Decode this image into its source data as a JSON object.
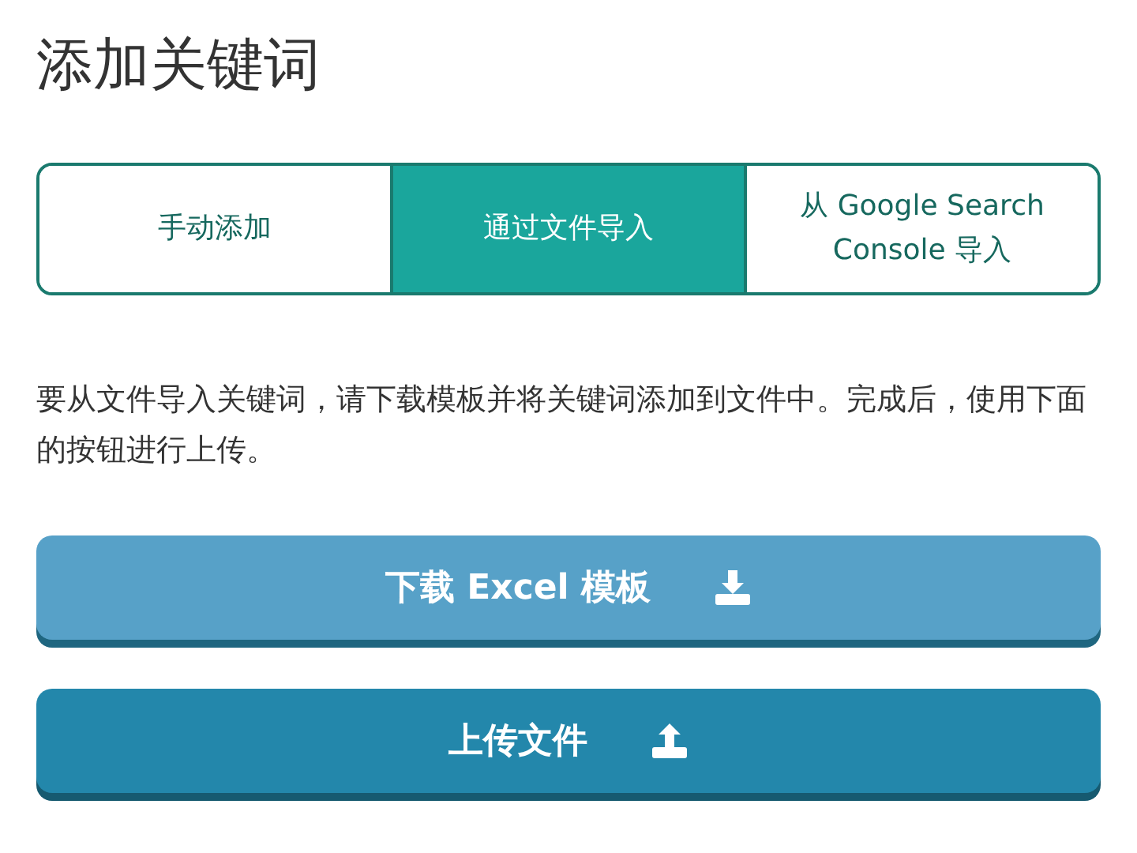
{
  "title": "添加关键词",
  "tabs": [
    {
      "label": "手动添加",
      "selected": false
    },
    {
      "label": "通过文件导入",
      "selected": true
    },
    {
      "label": "从 Google Search Console 导入",
      "selected": false
    }
  ],
  "instructions": "要从文件导入关键词，请下载模板并将关键词添加到文件中。完成后，使用下面的按钮进行上传。",
  "buttons": [
    {
      "label": "下载 Excel 模板",
      "kind": "download"
    },
    {
      "label": "上传文件",
      "kind": "upload"
    }
  ]
}
